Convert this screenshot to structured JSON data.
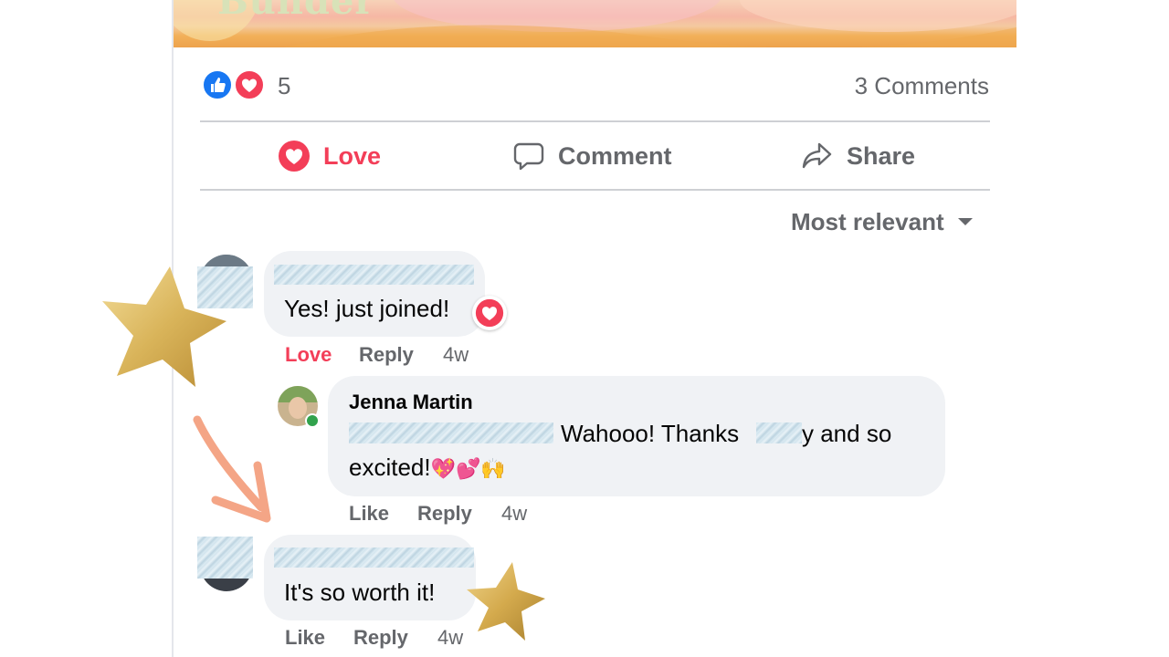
{
  "post": {
    "banner_title": "Bunder",
    "reaction_count": "5",
    "comments_count": "3 Comments",
    "reactions": [
      "like-icon",
      "heart-icon"
    ]
  },
  "actions": {
    "love_label": "Love",
    "comment_label": "Comment",
    "share_label": "Share"
  },
  "sort": {
    "label": "Most relevant"
  },
  "comments": [
    {
      "text": "Yes! just joined!",
      "reaction": "heart-icon",
      "actions": {
        "react_label": "Love",
        "reply_label": "Reply",
        "time": "4w"
      }
    },
    {
      "author": "Jenna Martin",
      "text_part1": "Wahooo! Thanks",
      "text_part2": "y and so",
      "text_line2": "excited!",
      "emojis": "💖💕🙌",
      "actions": {
        "react_label": "Like",
        "reply_label": "Reply",
        "time": "4w"
      }
    },
    {
      "text": "It's so worth it!",
      "actions": {
        "react_label": "Like",
        "reply_label": "Reply",
        "time": "4w"
      }
    }
  ],
  "colors": {
    "love_accent": "#f33e58",
    "like_blue": "#1877f2",
    "muted_text": "#65676b",
    "bubble_bg": "#f0f2f5",
    "star_gold": "#d9b45a",
    "arrow_coral": "#f4a586",
    "online_green": "#31a24c"
  }
}
